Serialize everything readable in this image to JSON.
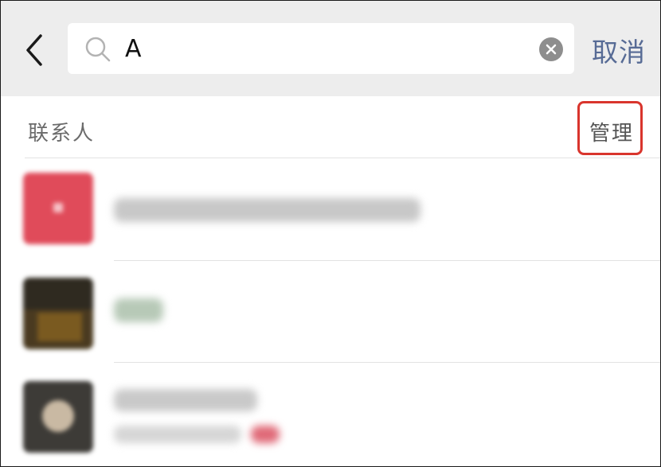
{
  "search": {
    "query": "A",
    "cancel_label": "取消"
  },
  "section": {
    "title": "联系人",
    "manage_label": "管理"
  },
  "colors": {
    "topbar_bg": "#ededed",
    "link_blue": "#576b95",
    "highlight_red": "#d9352d",
    "clear_icon_gray": "#8e8e8e"
  },
  "icons": [
    "back-arrow-icon",
    "search-icon",
    "clear-icon"
  ]
}
